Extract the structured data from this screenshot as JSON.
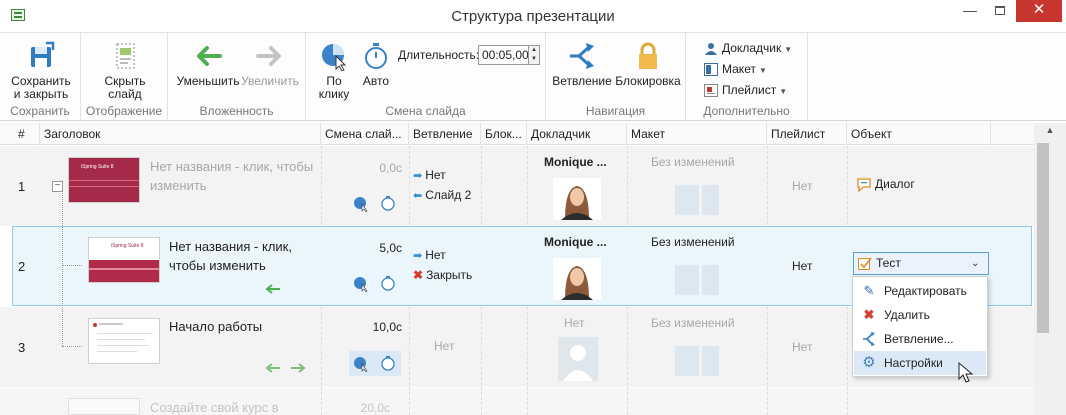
{
  "window": {
    "title": "Структура презентации",
    "minimize": "—",
    "close": "✕"
  },
  "ribbon": {
    "save": {
      "label1": "Сохранить",
      "label2": "и закрыть",
      "group": "Сохранить"
    },
    "display": {
      "label1": "Скрыть",
      "label2": "слайд",
      "group": "Отображение"
    },
    "nesting": {
      "decrease": "Уменьшить",
      "increase": "Увеличить",
      "group": "Вложенность"
    },
    "slide_change": {
      "on_click1": "По",
      "on_click2": "клику",
      "auto": "Авто",
      "duration_label": "Длительность:",
      "duration_value": "00:05,00",
      "group": "Смена слайда"
    },
    "navigation": {
      "branching": "Ветвление",
      "lock": "Блокировка",
      "group": "Навигация"
    },
    "extra": {
      "presenter": "Докладчик",
      "layout": "Макет",
      "playlist": "Плейлист",
      "group": "Дополнительно"
    }
  },
  "columns": [
    "#",
    "Заголовок",
    "Смена слай...",
    "Ветвление",
    "Блок...",
    "Докладчик",
    "Макет",
    "Плейлист",
    "Объект"
  ],
  "rows": [
    {
      "num": "1",
      "title_line1": "Нет названия - клик, чтобы",
      "title_line2": "изменить",
      "duration": "0,0с",
      "branch1": "Нет",
      "branch2": "Слайд 2",
      "presenter": "Monique ...",
      "layout": "Без изменений",
      "playlist": "Нет",
      "object": "Диалог",
      "thumb_text": "iSpring Suite 8"
    },
    {
      "num": "2",
      "title_line1": "Нет названия - клик,",
      "title_line2": "чтобы изменить",
      "duration": "5,0с",
      "branch1": "Нет",
      "branch2": "Закрыть",
      "presenter": "Monique ...",
      "layout": "Без изменений",
      "playlist": "Нет",
      "object": "Тест",
      "thumb_text": "iSpring Suite 8"
    },
    {
      "num": "3",
      "title": "Начало работы",
      "duration": "10,0с",
      "branch": "Нет",
      "presenter": "Нет",
      "layout": "Без изменений",
      "playlist": "Нет"
    },
    {
      "title": "Создайте свой курс в",
      "duration": "20,0с"
    }
  ],
  "context_menu": [
    "Редактировать",
    "Удалить",
    "Ветвление...",
    "Настройки"
  ],
  "colors": {
    "selection_border": "#8ec9ec",
    "selection_bg": "#eaf5fc",
    "accent_blue": "#2d8fd6",
    "nesting_green": "#4caf50",
    "slide_red": "#b02a4a"
  }
}
